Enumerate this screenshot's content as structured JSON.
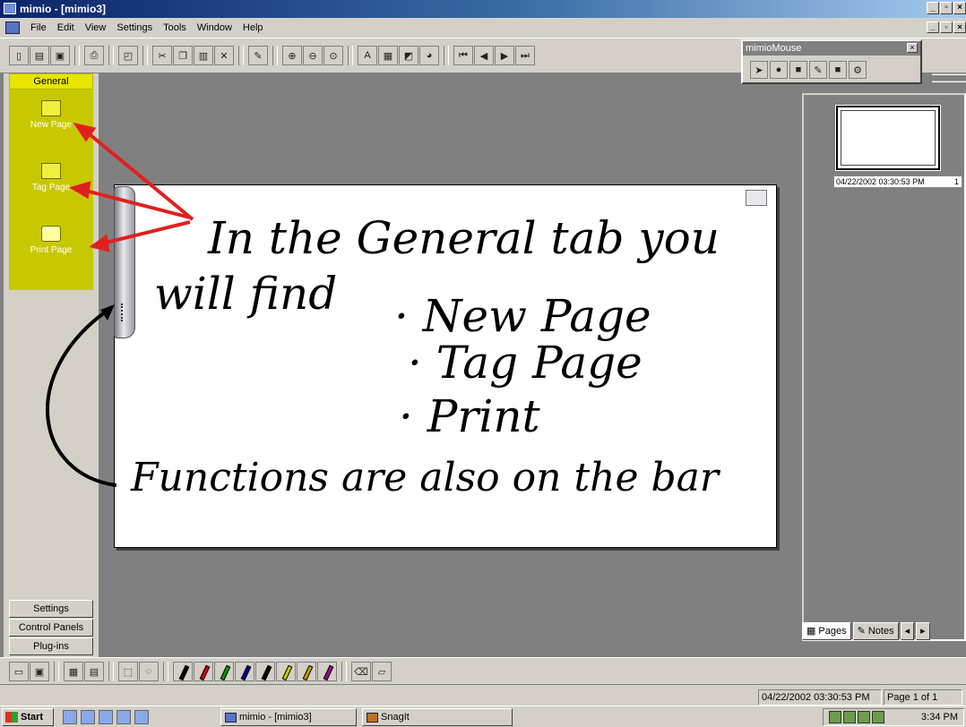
{
  "window": {
    "title": "mimio - [mimio3]"
  },
  "menu": [
    "File",
    "Edit",
    "View",
    "Settings",
    "Tools",
    "Window",
    "Help"
  ],
  "toolbar_icons": [
    "new-icon",
    "open-icon",
    "save-icon",
    "print-icon",
    "print-preview-icon",
    "cut-icon",
    "copy-icon",
    "paste-icon",
    "delete-icon",
    "pen-select-icon",
    "zoom-in-icon",
    "zoom-out-icon",
    "zoom-fit-icon",
    "recognize-text-icon",
    "import-icon",
    "screen-capture-icon",
    "color-icon",
    "first-page-icon",
    "prev-page-icon",
    "next-page-icon",
    "last-page-icon"
  ],
  "mimio_mouse": {
    "title": "mimioMouse"
  },
  "left_panel": {
    "active_tab": "General",
    "items": [
      {
        "label": "New Page",
        "icon": "new-page-icon"
      },
      {
        "label": "Tag Page",
        "icon": "tag-page-icon"
      },
      {
        "label": "Print Page",
        "icon": "print-page-icon"
      }
    ],
    "other_tabs": [
      "Settings",
      "Control Panels",
      "Plug-ins"
    ]
  },
  "canvas": {
    "handwriting": [
      "In the General tab you",
      "will find",
      "· New Page",
      "· Tag Page",
      "· Print",
      "Functions are also on the bar"
    ],
    "annotation_color": "#e02020",
    "ink_color": "#000000"
  },
  "thumbnail": {
    "caption": "04/22/2002 03:30:53 PM",
    "page_number": "1"
  },
  "right_tabs": [
    {
      "label": "Pages",
      "active": true
    },
    {
      "label": "Notes",
      "active": false
    }
  ],
  "pen_colors": [
    "#000000",
    "#cc0000",
    "#009900",
    "#000099",
    "#000000",
    "#cccc00",
    "#cc9900",
    "#990099"
  ],
  "status": {
    "timestamp": "04/22/2002 03:30:53 PM",
    "page": "Page 1 of 1"
  },
  "taskbar": {
    "start": "Start",
    "tasks": [
      "mimio - [mimio3]",
      "SnagIt"
    ],
    "clock": "3:34 PM"
  }
}
